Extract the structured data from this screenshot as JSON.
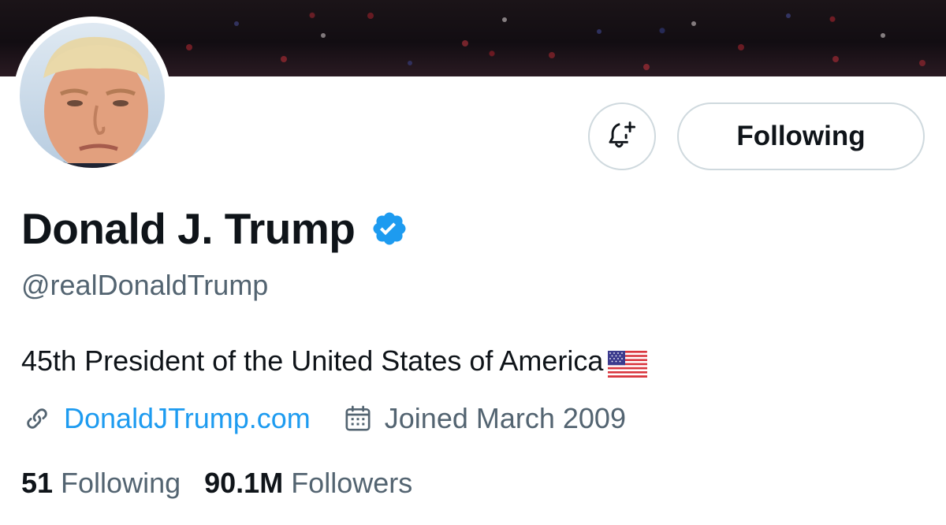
{
  "profile": {
    "display_name": "Donald J. Trump",
    "handle": "@realDonaldTrump",
    "bio": "45th President of the United States of America",
    "bio_emoji": "us-flag",
    "website": "DonaldJTrump.com",
    "joined": "Joined March 2009",
    "verified": true
  },
  "actions": {
    "notify_icon": "bell-plus-icon",
    "following_label": "Following"
  },
  "stats": {
    "following_count": "51",
    "following_label": "Following",
    "followers_count": "90.1M",
    "followers_label": "Followers"
  },
  "colors": {
    "accent": "#1d9bf0",
    "text_primary": "#0f1419",
    "text_secondary": "#536471",
    "border": "#cfd9de"
  }
}
